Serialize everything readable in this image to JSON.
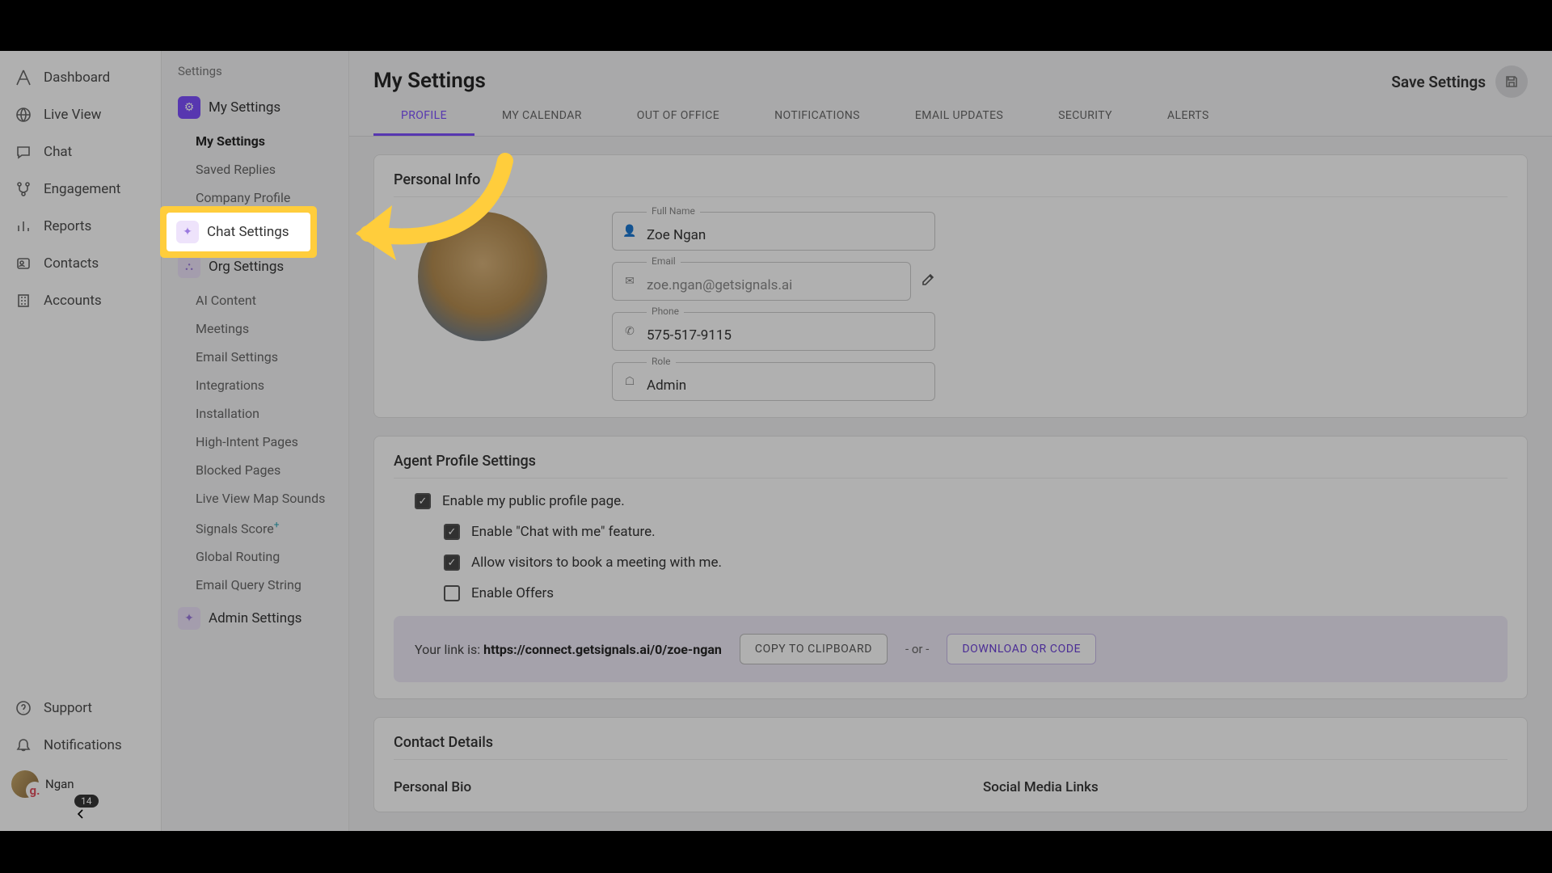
{
  "nav": {
    "dashboard": "Dashboard",
    "live_view": "Live View",
    "chat": "Chat",
    "engagement": "Engagement",
    "reports": "Reports",
    "contacts": "Contacts",
    "accounts": "Accounts",
    "support": "Support",
    "notifications": "Notifications",
    "user_name": "Ngan",
    "badge": "14"
  },
  "settings_nav": {
    "crumb": "Settings",
    "my_settings": "My Settings",
    "sub_my_settings": "My Settings",
    "sub_saved_replies": "Saved Replies",
    "sub_company_profile": "Company Profile",
    "chat_settings": "Chat Settings",
    "org_settings": "Org Settings",
    "ai_content": "AI Content",
    "meetings": "Meetings",
    "email_settings": "Email Settings",
    "integrations": "Integrations",
    "installation": "Installation",
    "high_intent_pages": "High-Intent Pages",
    "blocked_pages": "Blocked Pages",
    "live_view_map_sounds": "Live View Map Sounds",
    "signals_score": "Signals Score",
    "signals_score_badge": "+",
    "global_routing": "Global Routing",
    "email_query_string": "Email Query String",
    "admin_settings": "Admin Settings"
  },
  "topbar": {
    "title": "My Settings",
    "save": "Save Settings"
  },
  "tabs": {
    "profile": "PROFILE",
    "my_calendar": "MY CALENDAR",
    "out_of_office": "OUT OF OFFICE",
    "notifications": "NOTIFICATIONS",
    "email_updates": "EMAIL UPDATES",
    "security": "SECURITY",
    "alerts": "ALERTS"
  },
  "personal": {
    "heading": "Personal Info",
    "full_name_label": "Full Name",
    "full_name_value": "Zoe Ngan",
    "email_label": "Email",
    "email_value": "zoe.ngan@getsignals.ai",
    "phone_label": "Phone",
    "phone_value": "575-517-9115",
    "role_label": "Role",
    "role_value": "Admin"
  },
  "agent": {
    "heading": "Agent Profile Settings",
    "enable_public": "Enable my public profile page.",
    "enable_chat_with_me": "Enable \"Chat with me\" feature.",
    "allow_book_meeting": "Allow visitors to book a meeting with me.",
    "enable_offers": "Enable Offers",
    "link_pre": "Your link is: ",
    "link_url": "https://connect.getsignals.ai/0/zoe-ngan",
    "copy": "COPY TO CLIPBOARD",
    "or": "- or -",
    "download_qr": "DOWNLOAD QR CODE"
  },
  "contact": {
    "heading": "Contact Details",
    "personal_bio": "Personal Bio",
    "social_links": "Social Media Links"
  }
}
